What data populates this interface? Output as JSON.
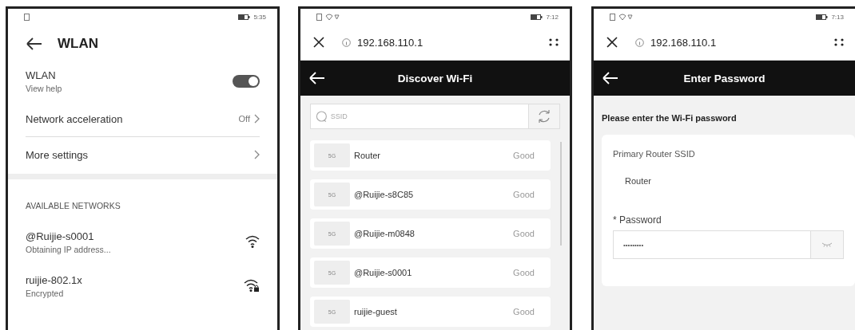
{
  "wlan_settings": {
    "status_time": "5:35",
    "title": "WLAN",
    "toggle_row": {
      "label": "WLAN",
      "sublabel": "View help",
      "on": true
    },
    "rows": [
      {
        "label": "Network acceleration",
        "value": "Off"
      },
      {
        "label": "More settings"
      }
    ],
    "section_header": "AVAILABLE NETWORKS",
    "networks": [
      {
        "name": "@Ruijie-s0001",
        "status": "Obtaining IP address...",
        "locked": false
      },
      {
        "name": "ruijie-802.1x",
        "status": "Encrypted",
        "locked": true
      }
    ]
  },
  "discover_wifi": {
    "status_time": "7:12",
    "address": "192.168.110.1",
    "title": "Discover Wi-Fi",
    "search": {
      "placeholder": "SSID"
    },
    "networks": [
      {
        "band": "5G",
        "ssid": "Router",
        "signal": "Good"
      },
      {
        "band": "5G",
        "ssid": "@Ruijie-s8C85",
        "signal": "Good"
      },
      {
        "band": "5G",
        "ssid": "@Ruijie-m0848",
        "signal": "Good"
      },
      {
        "band": "5G",
        "ssid": "@Ruijie-s0001",
        "signal": "Good"
      },
      {
        "band": "5G",
        "ssid": "ruijie-guest",
        "signal": "Good"
      }
    ]
  },
  "enter_password": {
    "status_time": "7:13",
    "address": "192.168.110.1",
    "title": "Enter Password",
    "prompt": "Please enter the Wi-Fi password",
    "ssid_label": "Primary Router SSID",
    "ssid_value": "Router",
    "password_label": "* Password",
    "password_value": "•••••••••"
  }
}
